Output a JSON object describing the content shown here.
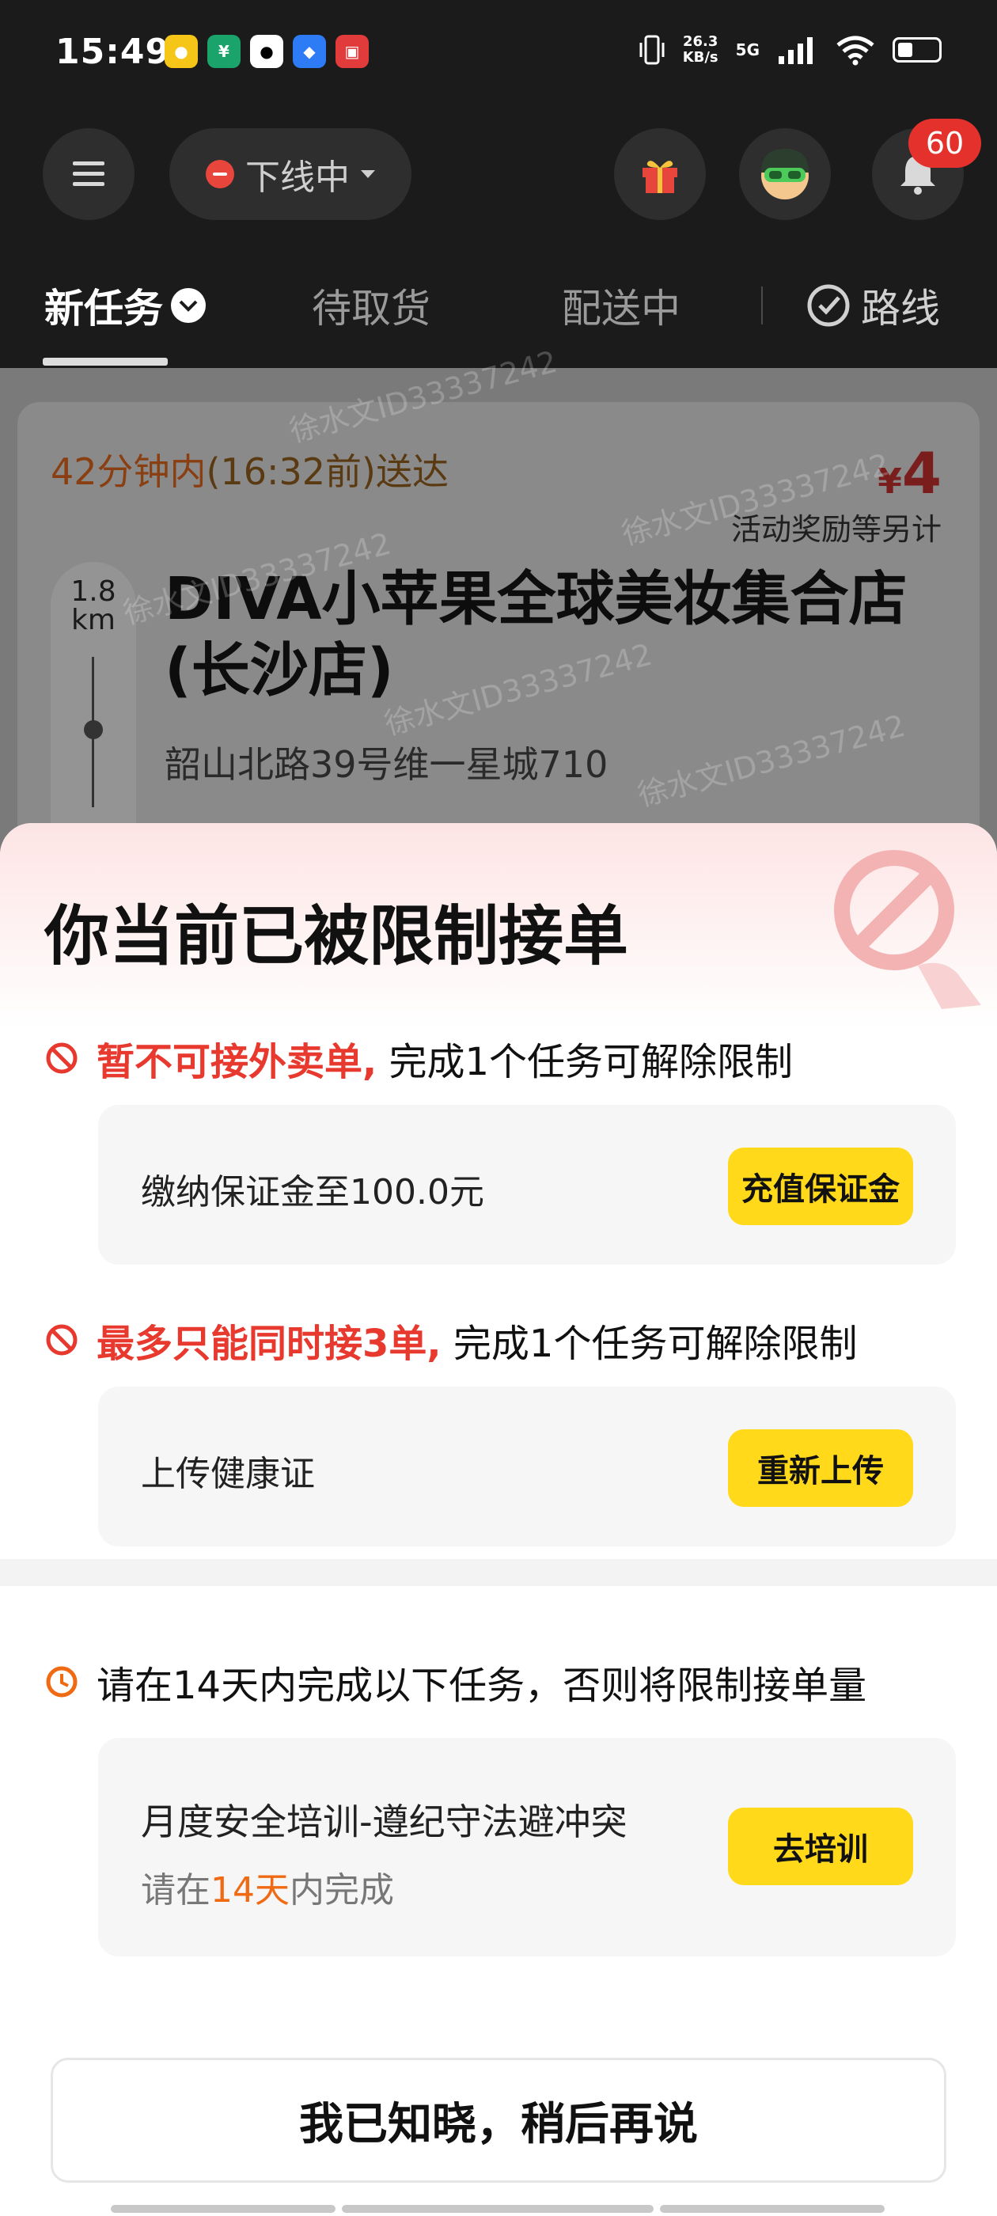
{
  "status_bar": {
    "time": "15:49",
    "network_speed_value": "26.3",
    "network_speed_unit": "KB/s",
    "network_type": "5G"
  },
  "toolbar": {
    "online_status": "下线中",
    "notification_count": "60"
  },
  "tabs": [
    {
      "label": "新任务"
    },
    {
      "label": "待取货"
    },
    {
      "label": "配送中"
    },
    {
      "label": "路线"
    }
  ],
  "task_card": {
    "time_highlight": "42分钟内",
    "time_rest": "(16:32前)送达",
    "price": "4",
    "currency": "¥",
    "reward_note": "活动奖励等另计",
    "distance_value": "1.8",
    "distance_unit": "km",
    "shop_name": "DIVA小苹果全球美妆集合店(长沙店)",
    "shop_address": "韶山北路39号维一星城710",
    "watermark": "徐水文ID33337242"
  },
  "sheet": {
    "title": "你当前已被限制接单",
    "rules": [
      {
        "red_text": "暂不可接外卖单,",
        "black_text": " 完成1个任务可解除限制",
        "requirement": "缴纳保证金至100.0元",
        "button": "充值保证金"
      },
      {
        "red_text": "最多只能同时接3单,",
        "black_text": " 完成1个任务可解除限制",
        "requirement": "上传健康证",
        "button": "重新上传"
      }
    ],
    "notice": "请在14天内完成以下任务，否则将限制接单量",
    "task": {
      "title": "月度安全培训-遵纪守法避冲突",
      "sub_prefix": "请在",
      "sub_highlight": "14天",
      "sub_suffix": "内完成",
      "button": "去培训"
    },
    "ack_button": "我已知晓，稍后再说"
  },
  "icons": {
    "menu": "menu-icon",
    "gift": "gift-icon",
    "avatar": "rider-avatar",
    "bell": "bell-icon",
    "route": "route-icon",
    "ban": "ban-icon",
    "clock": "clock-icon"
  },
  "colors": {
    "accent_yellow": "#ffd91a",
    "alert_red": "#e8392f",
    "highlight_orange": "#f06a14",
    "badge_red": "#e5312b"
  }
}
